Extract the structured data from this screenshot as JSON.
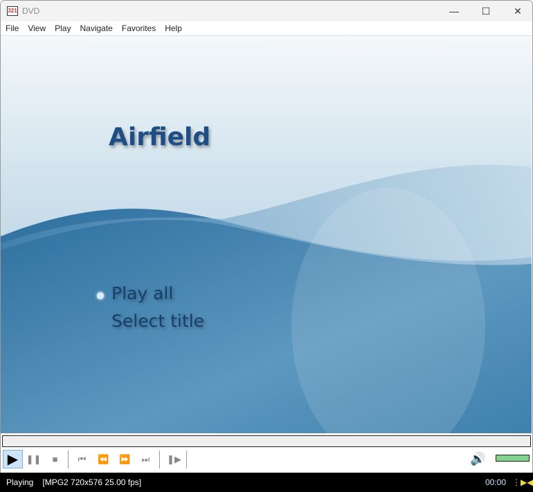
{
  "window": {
    "title": "DVD",
    "app_icon": "mpc-clapper-icon"
  },
  "menu": [
    "File",
    "View",
    "Play",
    "Navigate",
    "Favorites",
    "Help"
  ],
  "dvd_menu": {
    "heading": "Airfield",
    "items": [
      "Play all",
      "Select title"
    ],
    "selected_index": 0
  },
  "seek": {
    "progress": 0
  },
  "controls": {
    "buttons": [
      "play",
      "pause",
      "stop",
      "previous",
      "rewind",
      "fast-forward",
      "next",
      "frame-step"
    ],
    "volume": 1.0,
    "volume_color": "#80d48e"
  },
  "status": {
    "state": "Playing",
    "info": "[MPG2 720x576 25.00 fps]",
    "time": "00:00"
  }
}
